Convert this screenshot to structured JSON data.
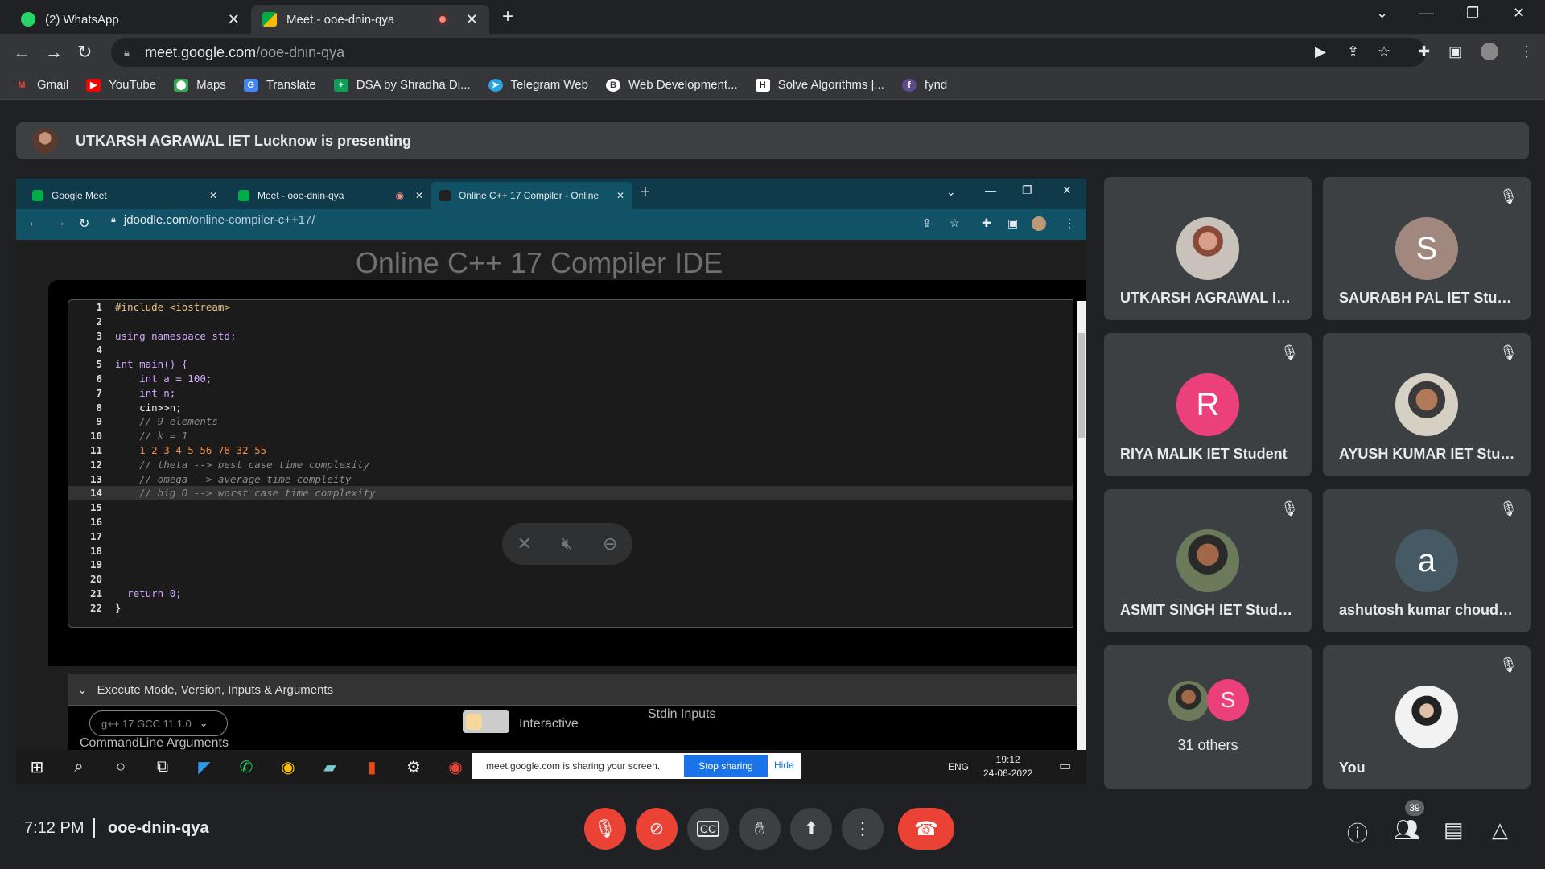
{
  "browser": {
    "tabs": [
      {
        "label": "(2) WhatsApp"
      },
      {
        "label": "Meet - ooe-dnin-qya"
      }
    ],
    "url_host": "meet.google.com",
    "url_path": "/ooe-dnin-qya",
    "bookmarks": [
      "Gmail",
      "YouTube",
      "Maps",
      "Translate",
      "DSA by Shradha Di...",
      "Telegram Web",
      "Web Development...",
      "Solve Algorithms |...",
      "fynd"
    ]
  },
  "meet": {
    "presenting_text": "UTKARSH AGRAWAL IET Lucknow is presenting",
    "time": "7:12 PM",
    "meeting_code": "ooe-dnin-qya",
    "participant_count": "39",
    "participants": [
      {
        "name": "UTKARSH AGRAWAL IET...",
        "initial": "",
        "color": "",
        "muted": false
      },
      {
        "name": "SAURABH PAL IET Stude...",
        "initial": "S",
        "color": "#a1887f",
        "muted": true
      },
      {
        "name": "RIYA MALIK IET Student",
        "initial": "R",
        "color": "#ec407a",
        "muted": true
      },
      {
        "name": "AYUSH KUMAR IET Stud...",
        "initial": "",
        "color": "",
        "muted": true
      },
      {
        "name": "ASMIT SINGH IET Student",
        "initial": "",
        "color": "",
        "muted": true
      },
      {
        "name": "ashutosh kumar choudh...",
        "initial": "a",
        "color": "#455a64",
        "muted": true
      },
      {
        "name": "31 others",
        "initial": "S",
        "color": "#ec407a",
        "muted": false
      },
      {
        "name": "You",
        "initial": "",
        "color": "",
        "muted": true
      }
    ]
  },
  "shared": {
    "tabs": [
      "Google Meet",
      "Meet - ooe-dnin-qya",
      "Online C++ 17 Compiler - Online"
    ],
    "url_host": "jdoodle.com",
    "url_path": "/online-compiler-c++17/",
    "page_title": "Online C++ 17 Compiler IDE",
    "exec_section": "Execute Mode, Version, Inputs & Arguments",
    "version": "g++ 17 GCC 11.1.0",
    "interactive_label": "Interactive",
    "stdin_label": "Stdin Inputs",
    "cmdline_label": "CommandLine Arguments",
    "share_notice": "meet.google.com is sharing your screen.",
    "stop_sharing": "Stop sharing",
    "hide": "Hide",
    "lang": "ENG",
    "clock_time": "19:12",
    "clock_date": "24-06-2022",
    "code_lines": [
      "#include <iostream>",
      "",
      "using namespace std;",
      "",
      "int main() {",
      "    int a = 100;",
      "    int n;",
      "    cin>>n;",
      "    // 9 elements",
      "    // k = 1",
      "    1 2 3 4 5 56 78 32 55",
      "    // theta --> best case time complexity",
      "    // omega --> average time compleity",
      "    // big O --> worst case time complexity",
      "",
      "",
      "",
      "",
      "",
      "",
      "  return 0;",
      "}"
    ]
  }
}
